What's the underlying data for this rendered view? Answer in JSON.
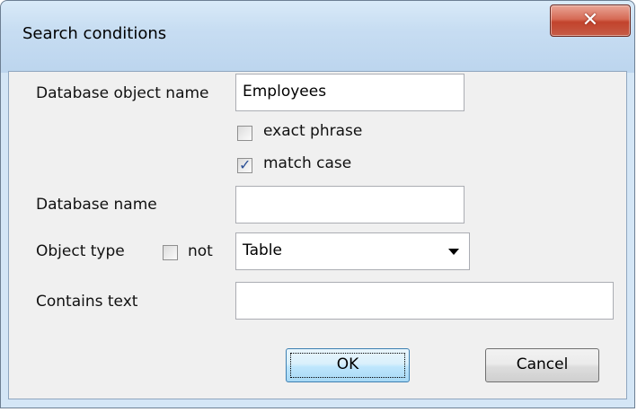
{
  "window": {
    "title": "Search conditions",
    "close_glyph": "✕"
  },
  "form": {
    "db_object_name_label": "Database object name",
    "db_object_name_value": "Employees",
    "exact_phrase_label": "exact phrase",
    "exact_phrase_checked": false,
    "match_case_label": "match case",
    "match_case_checked": true,
    "database_name_label": "Database name",
    "database_name_value": "",
    "object_type_label": "Object type",
    "not_label": "not",
    "not_checked": false,
    "object_type_value": "Table",
    "contains_text_label": "Contains text",
    "contains_text_value": ""
  },
  "buttons": {
    "ok": "OK",
    "cancel": "Cancel"
  },
  "icons": {
    "check": "✓",
    "dropdown": "chevron-down-icon",
    "close": "close-icon"
  }
}
